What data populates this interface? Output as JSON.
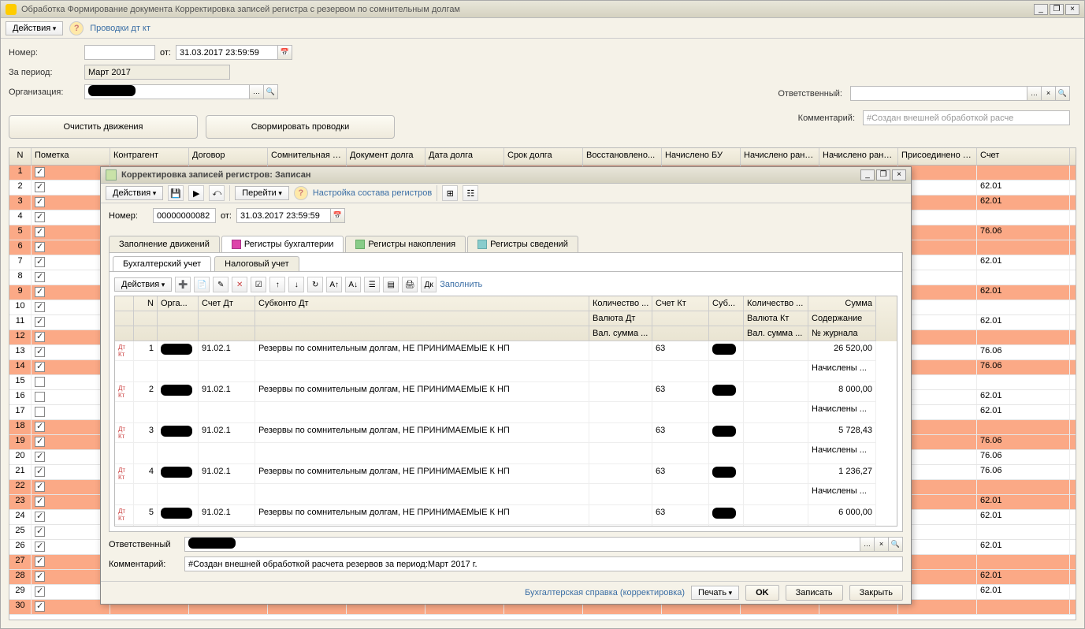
{
  "main": {
    "title": "Обработка  Формирование документа Корректировка записей регистра с резервом по сомнительным долгам",
    "actions_label": "Действия",
    "help_icon": "?",
    "link_provodki": "Проводки дт кт",
    "number_label": "Номер:",
    "from_label": "от:",
    "date_value": "31.03.2017 23:59:59",
    "period_label": "За период:",
    "period_value": "Март 2017",
    "org_label": "Организация:",
    "responsible_label": "Ответственный:",
    "comment_label": "Комментарий:",
    "comment_placeholder": "#Создан внешней обработкой расче",
    "btn_clear": "Очистить движения",
    "btn_form": "Свормировать проводки"
  },
  "grid": {
    "headers": {
      "n": "N",
      "mark": "Пометка",
      "contragent": "Контрагент",
      "dogovor": "Договор",
      "somn": "Сомнительная з...",
      "docdolg": "Документ долга",
      "datadolga": "Дата долга",
      "srok": "Срок долга",
      "vost": "Восстановлено...",
      "nachbu": "Начислено БУ",
      "nachr1": "Начислено ране...",
      "nachr2": "Начислено ране...",
      "pris": "Присоединено БУ",
      "schet": "Счет"
    },
    "rows": [
      {
        "n": 1,
        "checked": true,
        "orange": true,
        "schet": ""
      },
      {
        "n": 2,
        "checked": true,
        "orange": false,
        "schet": "62.01"
      },
      {
        "n": 3,
        "checked": true,
        "orange": true,
        "schet": "62.01"
      },
      {
        "n": 4,
        "checked": true,
        "orange": false,
        "schet": ""
      },
      {
        "n": 5,
        "checked": true,
        "orange": true,
        "schet": "76.06"
      },
      {
        "n": 6,
        "checked": true,
        "orange": true,
        "schet": ""
      },
      {
        "n": 7,
        "checked": true,
        "orange": false,
        "schet": "62.01"
      },
      {
        "n": 8,
        "checked": true,
        "orange": false,
        "schet": ""
      },
      {
        "n": 9,
        "checked": true,
        "orange": true,
        "schet": "62.01"
      },
      {
        "n": 10,
        "checked": true,
        "orange": false,
        "schet": ""
      },
      {
        "n": 11,
        "checked": true,
        "orange": false,
        "schet": "62.01"
      },
      {
        "n": 12,
        "checked": true,
        "orange": true,
        "schet": ""
      },
      {
        "n": 13,
        "checked": true,
        "orange": false,
        "schet": "76.06"
      },
      {
        "n": 14,
        "checked": true,
        "orange": true,
        "schet": "76.06"
      },
      {
        "n": 15,
        "checked": false,
        "orange": false,
        "schet": ""
      },
      {
        "n": 16,
        "checked": false,
        "orange": false,
        "schet": "62.01"
      },
      {
        "n": 17,
        "checked": false,
        "orange": false,
        "schet": "62.01"
      },
      {
        "n": 18,
        "checked": true,
        "orange": true,
        "schet": ""
      },
      {
        "n": 19,
        "checked": true,
        "orange": true,
        "schet": "76.06"
      },
      {
        "n": 20,
        "checked": true,
        "orange": false,
        "schet": "76.06"
      },
      {
        "n": 21,
        "checked": true,
        "orange": false,
        "schet": "76.06"
      },
      {
        "n": 22,
        "checked": true,
        "orange": true,
        "schet": ""
      },
      {
        "n": 23,
        "checked": true,
        "orange": true,
        "schet": "62.01"
      },
      {
        "n": 24,
        "checked": true,
        "orange": false,
        "schet": "62.01"
      },
      {
        "n": 25,
        "checked": true,
        "orange": false,
        "schet": ""
      },
      {
        "n": 26,
        "checked": true,
        "orange": false,
        "schet": "62.01"
      },
      {
        "n": 27,
        "checked": true,
        "orange": true,
        "schet": ""
      },
      {
        "n": 28,
        "checked": true,
        "orange": true,
        "schet": "62.01"
      },
      {
        "n": 29,
        "checked": true,
        "orange": false,
        "schet": "62.01"
      },
      {
        "n": 30,
        "checked": true,
        "orange": true,
        "schet": ""
      }
    ]
  },
  "dialog": {
    "title": "Корректировка записей регистров: Записан",
    "actions": "Действия",
    "goto": "Перейти",
    "help": "?",
    "config": "Настройка состава регистров",
    "number_label": "Номер:",
    "number_value": "00000000082",
    "from_label": "от:",
    "date_value": "31.03.2017 23:59:59",
    "tabs": {
      "t1": "Заполнение движений",
      "t2": "Регистры бухгалтерии",
      "t3": "Регистры накопления",
      "t4": "Регистры сведений"
    },
    "inner_tabs": {
      "a": "Бухгалтерский учет",
      "b": "Налоговый учет"
    },
    "actions2": "Действия",
    "fill": "Заполнить",
    "ig_headers": {
      "n": "N",
      "org": "Орга...",
      "schd": "Счет Дт",
      "sub": "Субконто Дт",
      "kol": "Количество ...",
      "schk": "Счет Кт",
      "subk": "Суб...",
      "kolk": "Количество ...",
      "sum": "Сумма",
      "valdt": "Валюта Дт",
      "valkt": "Валюта Кт",
      "sod": "Содержание",
      "valsumdt": "Вал. сумма ...",
      "valsumkt": "Вал. сумма ...",
      "jour": "№ журнала"
    },
    "ig_rows": [
      {
        "n": 1,
        "schd": "91.02.1",
        "sub": "Резервы по сомнительным долгам, НЕ ПРИНИМАЕМЫЕ К НП",
        "schk": "63",
        "sum": "26 520,00",
        "sod": "Начислены ..."
      },
      {
        "n": 2,
        "schd": "91.02.1",
        "sub": "Резервы по сомнительным долгам, НЕ ПРИНИМАЕМЫЕ К НП",
        "schk": "63",
        "sum": "8 000,00",
        "sod": "Начислены ..."
      },
      {
        "n": 3,
        "schd": "91.02.1",
        "sub": "Резервы по сомнительным долгам, НЕ ПРИНИМАЕМЫЕ К НП",
        "schk": "63",
        "sum": "5 728,43",
        "sod": "Начислены ..."
      },
      {
        "n": 4,
        "schd": "91.02.1",
        "sub": "Резервы по сомнительным долгам, НЕ ПРИНИМАЕМЫЕ К НП",
        "schk": "63",
        "sum": "1 236,27",
        "sod": "Начислены ..."
      },
      {
        "n": 5,
        "schd": "91.02.1",
        "sub": "Резервы по сомнительным долгам, НЕ ПРИНИМАЕМЫЕ К НП",
        "schk": "63",
        "sum": "6 000,00",
        "sod": ""
      }
    ],
    "responsible_label": "Ответственный",
    "comment_label": "Комментарий:",
    "comment_value": "#Создан внешней обработкой расчета резервов за период:Март 2017 г.",
    "footer": {
      "link": "Бухгалтерская справка (корректировка)",
      "print": "Печать",
      "ok": "OK",
      "save": "Записать",
      "close": "Закрыть"
    }
  }
}
